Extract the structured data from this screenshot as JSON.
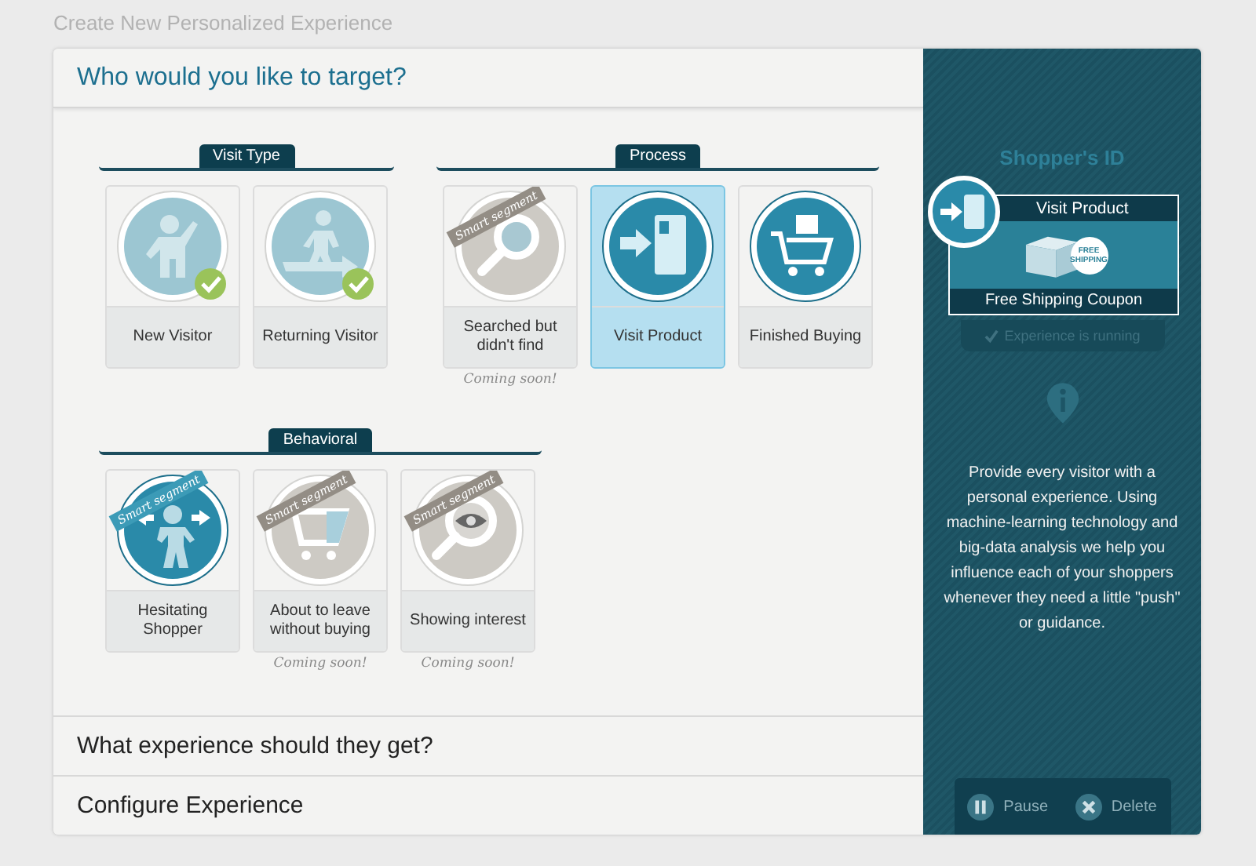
{
  "page_title": "Create New Personalized Experience",
  "sections": [
    {
      "title": "Who would you like to target?",
      "expanded": true
    },
    {
      "title": "What experience should they get?",
      "expanded": false
    },
    {
      "title": "Configure Experience",
      "expanded": false
    }
  ],
  "groups": [
    {
      "label": "Visit Type",
      "tiles": [
        {
          "label": "New Visitor",
          "selected": false,
          "checked": true,
          "disabled": false
        },
        {
          "label": "Returning Visitor",
          "selected": false,
          "checked": true,
          "disabled": false
        }
      ]
    },
    {
      "label": "Process",
      "tiles": [
        {
          "label": "Searched but didn't find",
          "selected": false,
          "checked": false,
          "disabled": true,
          "ribbon": "Smart segment",
          "note": "Coming soon!"
        },
        {
          "label": "Visit Product",
          "selected": true,
          "checked": false,
          "disabled": false
        },
        {
          "label": "Finished Buying",
          "selected": false,
          "checked": false,
          "disabled": false
        }
      ]
    },
    {
      "label": "Behavioral",
      "tiles": [
        {
          "label": "Hesitating Shopper",
          "selected": false,
          "checked": false,
          "disabled": false,
          "ribbon": "Smart segment"
        },
        {
          "label": "About to leave without buying",
          "selected": false,
          "checked": false,
          "disabled": true,
          "ribbon": "Smart segment",
          "note": "Coming soon!"
        },
        {
          "label": "Showing interest",
          "selected": false,
          "checked": false,
          "disabled": true,
          "ribbon": "Smart segment",
          "note": "Coming soon!"
        }
      ]
    }
  ],
  "sidebar": {
    "heading": "Shopper's ID",
    "card": {
      "title": "Visit Product",
      "badge": "FREE SHIPPING",
      "caption": "Free Shipping Coupon"
    },
    "status": "Experience is running",
    "description": "Provide every visitor with a personal experience. Using machine-learning technology and big-data analysis we help you influence each of your shoppers whenever they need a little \"push\" or guidance.",
    "buttons": [
      {
        "label": "Pause",
        "kind": "pause"
      },
      {
        "label": "Delete",
        "kind": "delete"
      }
    ]
  }
}
